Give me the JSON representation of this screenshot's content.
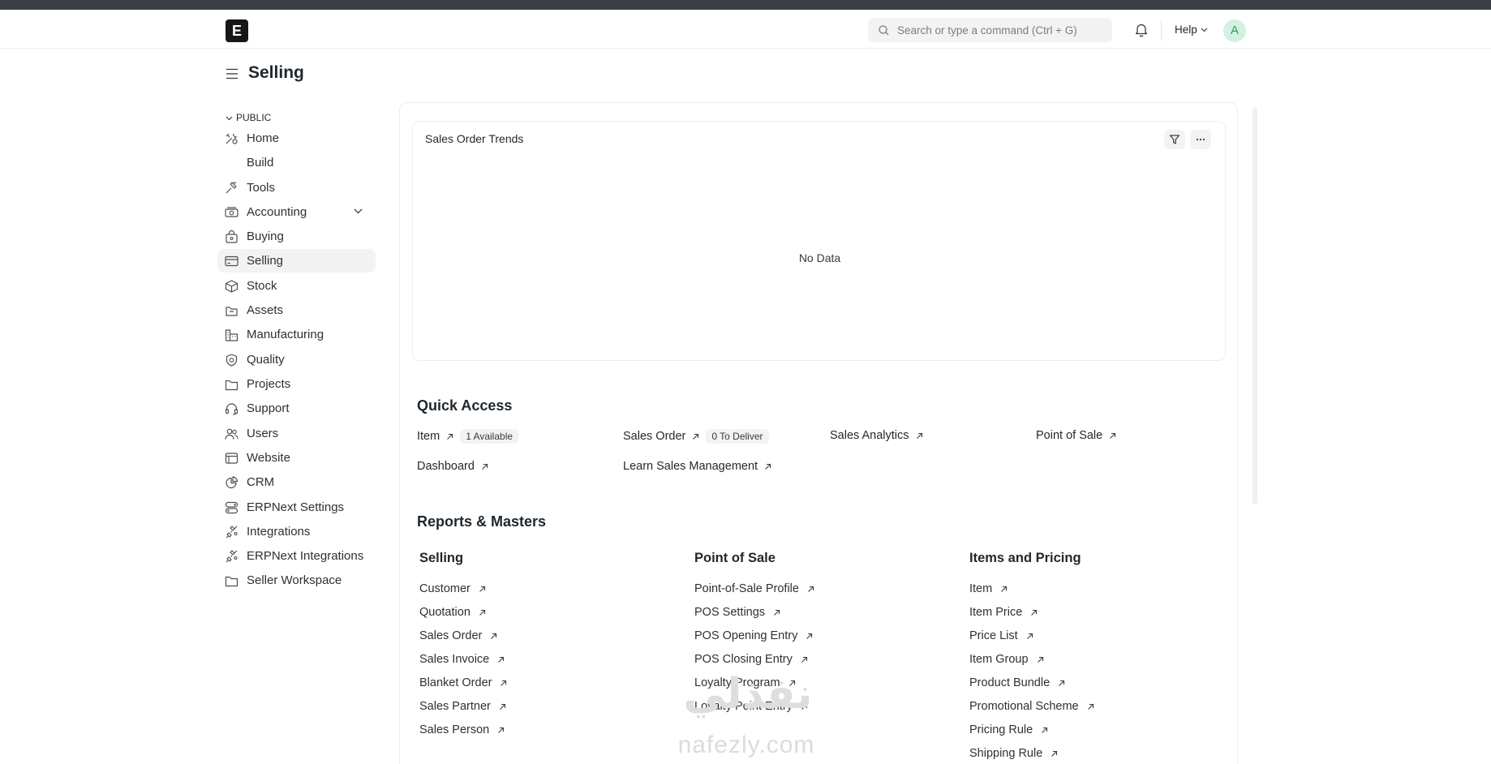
{
  "navbar": {
    "logo_letter": "E",
    "search_placeholder": "Search or type a command (Ctrl + G)",
    "help_label": "Help",
    "avatar_letter": "A"
  },
  "page": {
    "title": "Selling"
  },
  "sidebar": {
    "section_label": "PUBLIC",
    "items": [
      {
        "label": "Home",
        "icon": "tools-icon"
      },
      {
        "label": "Build",
        "icon": ""
      },
      {
        "label": "Tools",
        "icon": "hammer-icon"
      },
      {
        "label": "Accounting",
        "icon": "money-icon"
      },
      {
        "label": "Buying",
        "icon": "bag-icon"
      },
      {
        "label": "Selling",
        "icon": "card-icon"
      },
      {
        "label": "Stock",
        "icon": "box-icon"
      },
      {
        "label": "Assets",
        "icon": "folder-icon"
      },
      {
        "label": "Manufacturing",
        "icon": "factory-icon"
      },
      {
        "label": "Quality",
        "icon": "shield-icon"
      },
      {
        "label": "Projects",
        "icon": "folder-icon"
      },
      {
        "label": "Support",
        "icon": "headset-icon"
      },
      {
        "label": "Users",
        "icon": "users-icon"
      },
      {
        "label": "Website",
        "icon": "browser-icon"
      },
      {
        "label": "CRM",
        "icon": "pie-icon"
      },
      {
        "label": "ERPNext Settings",
        "icon": "toggle-icon"
      },
      {
        "label": "Integrations",
        "icon": "plug-icon"
      },
      {
        "label": "ERPNext Integrations",
        "icon": "plug-icon"
      },
      {
        "label": "Seller Workspace",
        "icon": "folder-icon"
      }
    ]
  },
  "chart": {
    "title": "Sales Order Trends",
    "empty_text": "No Data"
  },
  "quick_access": {
    "heading": "Quick Access",
    "links": [
      {
        "label": "Item",
        "badge": "1 Available"
      },
      {
        "label": "Sales Order",
        "badge": "0 To Deliver"
      },
      {
        "label": "Sales Analytics",
        "badge": ""
      },
      {
        "label": "Point of Sale",
        "badge": ""
      },
      {
        "label": "Dashboard",
        "badge": ""
      },
      {
        "label": "Learn Sales Management",
        "badge": ""
      }
    ]
  },
  "reports": {
    "heading": "Reports & Masters",
    "columns": [
      {
        "title": "Selling",
        "links": [
          "Customer",
          "Quotation",
          "Sales Order",
          "Sales Invoice",
          "Blanket Order",
          "Sales Partner",
          "Sales Person"
        ]
      },
      {
        "title": "Point of Sale",
        "links": [
          "Point-of-Sale Profile",
          "POS Settings",
          "POS Opening Entry",
          "POS Closing Entry",
          "Loyalty Program",
          "Loyalty Point Entry"
        ]
      },
      {
        "title": "Items and Pricing",
        "links": [
          "Item",
          "Item Price",
          "Price List",
          "Item Group",
          "Product Bundle",
          "Promotional Scheme",
          "Pricing Rule",
          "Shipping Rule"
        ]
      }
    ]
  },
  "watermark": {
    "arabic": "نفذلي",
    "latin": "nafezly.com"
  },
  "colors": {
    "active_bg": "#f3f3f3",
    "avatar_bg": "#d3f1e0",
    "avatar_fg": "#2f9d5e"
  }
}
